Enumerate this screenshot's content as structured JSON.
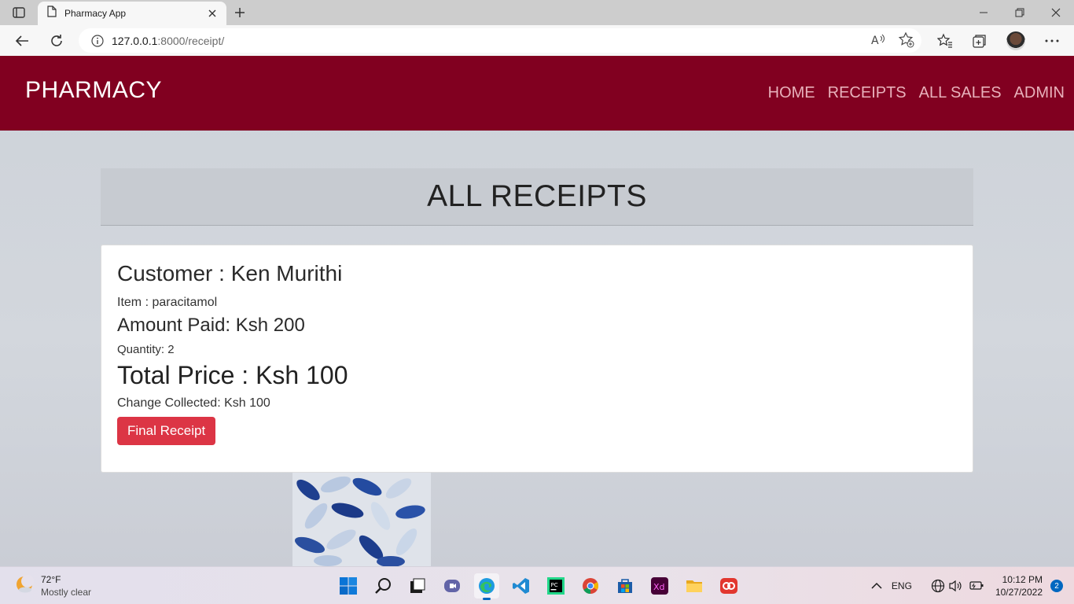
{
  "browser": {
    "tab_title": "Pharmacy App",
    "url_host": "127.0.0.1",
    "url_path": ":8000/receipt/"
  },
  "navbar": {
    "brand": "PHARMACY",
    "links": [
      "HOME",
      "RECEIPTS",
      "ALL SALES",
      "ADMIN"
    ]
  },
  "page": {
    "title": "ALL RECEIPTS"
  },
  "receipt": {
    "customer": "Customer : Ken Murithi",
    "item": "Item : paracitamol",
    "amount_paid": "Amount Paid: Ksh 200",
    "quantity": "Quantity: 2",
    "total_price": "Total Price : Ksh 100",
    "change": "Change Collected: Ksh 100",
    "button": "Final Receipt"
  },
  "taskbar": {
    "weather_temp": "72°F",
    "weather_cond": "Mostly clear",
    "language": "ENG",
    "time": "10:12 PM",
    "date": "10/27/2022",
    "notifications": "2"
  },
  "colors": {
    "navbar": "#810020",
    "button": "#dc3545"
  }
}
